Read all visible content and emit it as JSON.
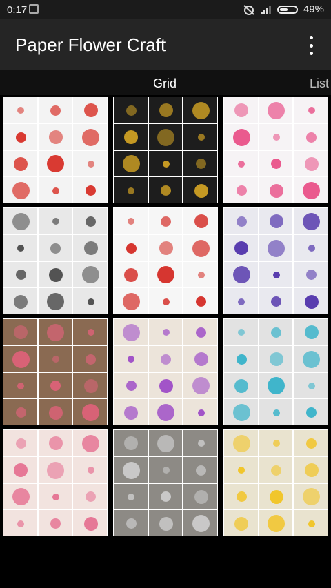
{
  "status": {
    "time": "0:17",
    "battery": "49%"
  },
  "app": {
    "title": "Paper Flower Craft"
  },
  "tabs": [
    {
      "label": "Grid"
    },
    {
      "label": "List"
    }
  ],
  "tiles": [
    {
      "name": "red-paper-rose-tile",
      "color": "#d6281f",
      "bg": "#f3f3f3"
    },
    {
      "name": "lotus-flower-tile",
      "color": "#d6a624",
      "bg": "#1d1d1d"
    },
    {
      "name": "pink-flower-tile",
      "color": "#e84b84",
      "bg": "#f6f3f5"
    },
    {
      "name": "spiral-rose-tile",
      "color": "#444444",
      "bg": "#e8e8e8"
    },
    {
      "name": "red-origami-flower-tile",
      "color": "#d2221c",
      "bg": "#f6f6f6"
    },
    {
      "name": "purple-star-flower-tile",
      "color": "#4b2ca8",
      "bg": "#e9e9ef"
    },
    {
      "name": "pink-dahlia-tile",
      "color": "#e0627a",
      "bg": "#8a6a52"
    },
    {
      "name": "purple-tulip-tile",
      "color": "#9a45c6",
      "bg": "#ece4da"
    },
    {
      "name": "blue-kusudama-tile",
      "color": "#2fb0c8",
      "bg": "#e2e2e2"
    },
    {
      "name": "pink-origami-lily-tile",
      "color": "#e56d8f",
      "bg": "#f2e3df"
    },
    {
      "name": "white-paper-flower-tile",
      "color": "#cfcfcf",
      "bg": "#8d8a85"
    },
    {
      "name": "yellow-kusudama-tile",
      "color": "#f2c21c",
      "bg": "#e9e3cf"
    }
  ]
}
